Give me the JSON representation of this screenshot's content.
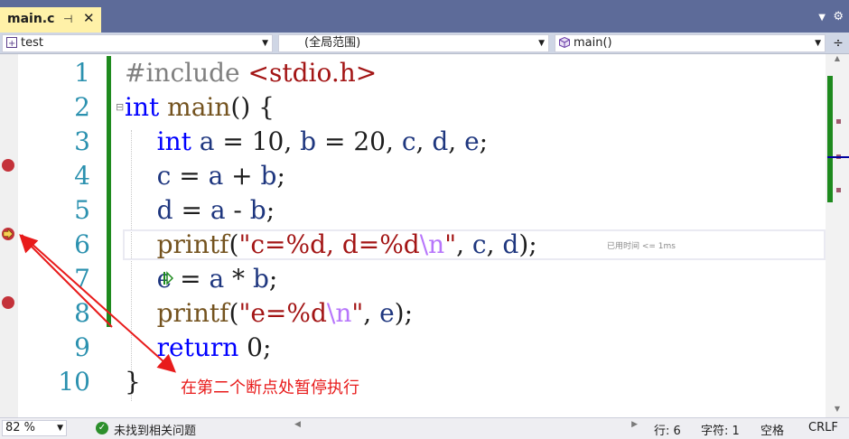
{
  "tab": {
    "title": "main.c",
    "pin": "⊣",
    "close": "✕"
  },
  "nav": {
    "project": "test",
    "scope": "(全局范围)",
    "member": "main()",
    "split": "÷"
  },
  "line_numbers": [
    "1",
    "2",
    "3",
    "4",
    "5",
    "6",
    "7",
    "8",
    "9",
    "10"
  ],
  "code_lines": [
    [
      {
        "t": "#include ",
        "c": "pp"
      },
      {
        "t": "<stdio.h>",
        "c": "str"
      }
    ],
    [
      {
        "t": "int",
        "c": "kw"
      },
      {
        "t": " ",
        "c": ""
      },
      {
        "t": "main",
        "c": "fn"
      },
      {
        "t": "() {",
        "c": ""
      }
    ],
    [
      {
        "t": "    ",
        "c": ""
      },
      {
        "t": "int",
        "c": "kw"
      },
      {
        "t": " ",
        "c": ""
      },
      {
        "t": "a",
        "c": "var"
      },
      {
        "t": " = 10, ",
        "c": ""
      },
      {
        "t": "b",
        "c": "var"
      },
      {
        "t": " = 20, ",
        "c": ""
      },
      {
        "t": "c",
        "c": "var"
      },
      {
        "t": ", ",
        "c": ""
      },
      {
        "t": "d",
        "c": "var"
      },
      {
        "t": ", ",
        "c": ""
      },
      {
        "t": "e",
        "c": "var"
      },
      {
        "t": ";",
        "c": ""
      }
    ],
    [
      {
        "t": "    ",
        "c": ""
      },
      {
        "t": "c",
        "c": "var"
      },
      {
        "t": " = ",
        "c": ""
      },
      {
        "t": "a",
        "c": "var"
      },
      {
        "t": " + ",
        "c": ""
      },
      {
        "t": "b",
        "c": "var"
      },
      {
        "t": ";",
        "c": ""
      }
    ],
    [
      {
        "t": "    ",
        "c": ""
      },
      {
        "t": "d",
        "c": "var"
      },
      {
        "t": " = ",
        "c": ""
      },
      {
        "t": "a",
        "c": "var"
      },
      {
        "t": " - ",
        "c": ""
      },
      {
        "t": "b",
        "c": "var"
      },
      {
        "t": ";",
        "c": ""
      }
    ],
    [
      {
        "t": "    ",
        "c": ""
      },
      {
        "t": "printf",
        "c": "fn"
      },
      {
        "t": "(",
        "c": ""
      },
      {
        "t": "\"c=%d, d=%d",
        "c": "str"
      },
      {
        "t": "\\n",
        "c": "esc"
      },
      {
        "t": "\"",
        "c": "str"
      },
      {
        "t": ", ",
        "c": ""
      },
      {
        "t": "c",
        "c": "var"
      },
      {
        "t": ", ",
        "c": ""
      },
      {
        "t": "d",
        "c": "var"
      },
      {
        "t": ");",
        "c": ""
      }
    ],
    [
      {
        "t": "    ",
        "c": ""
      },
      {
        "t": "e",
        "c": "var"
      },
      {
        "t": " = ",
        "c": ""
      },
      {
        "t": "a",
        "c": "var"
      },
      {
        "t": " * ",
        "c": ""
      },
      {
        "t": "b",
        "c": "var"
      },
      {
        "t": ";",
        "c": ""
      }
    ],
    [
      {
        "t": "    ",
        "c": ""
      },
      {
        "t": "printf",
        "c": "fn"
      },
      {
        "t": "(",
        "c": ""
      },
      {
        "t": "\"e=%d",
        "c": "str"
      },
      {
        "t": "\\n",
        "c": "esc"
      },
      {
        "t": "\"",
        "c": "str"
      },
      {
        "t": ", ",
        "c": ""
      },
      {
        "t": "e",
        "c": "var"
      },
      {
        "t": ");",
        "c": ""
      }
    ],
    [
      {
        "t": "    ",
        "c": ""
      },
      {
        "t": "return",
        "c": "kw"
      },
      {
        "t": " 0;",
        "c": ""
      }
    ],
    [
      {
        "t": "}",
        "c": ""
      }
    ]
  ],
  "perf_hint": "已用时间 <= 1ms",
  "annotation": "在第二个断点处暂停执行",
  "status": {
    "zoom": "82 %",
    "issues": "未找到相关问题",
    "line": "行: 6",
    "col": "字符: 1",
    "indent": "空格",
    "eol": "CRLF"
  },
  "colors": {
    "breakpoint": "#c4323a",
    "annotation": "#e81b1b",
    "changebar": "#1e8a1e"
  }
}
